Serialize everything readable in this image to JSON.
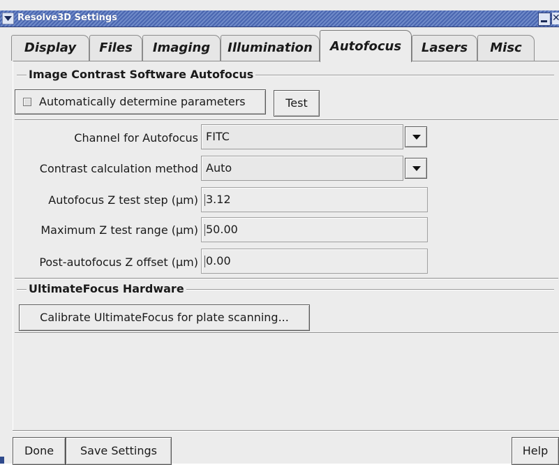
{
  "window": {
    "title": "Resolve3D Settings",
    "title_bar_color": "#4a66b0"
  },
  "tabs": [
    {
      "label": "Display",
      "active": false
    },
    {
      "label": "Files",
      "active": false
    },
    {
      "label": "Imaging",
      "active": false
    },
    {
      "label": "Illumination",
      "active": false
    },
    {
      "label": "Autofocus",
      "active": true
    },
    {
      "label": "Lasers",
      "active": false
    },
    {
      "label": "Misc",
      "active": false
    }
  ],
  "contrast_section": {
    "title": "Image Contrast Software Autofocus",
    "auto_checkbox_label": "Automatically determine parameters",
    "auto_checked": false,
    "test_button": "Test"
  },
  "fields": {
    "channel": {
      "label": "Channel for Autofocus",
      "value": "FITC"
    },
    "method": {
      "label": "Contrast calculation method",
      "value": "Auto"
    },
    "z_step": {
      "label": "Autofocus Z test step (µm)",
      "value": "3.12"
    },
    "z_range": {
      "label": "Maximum Z test range (µm)",
      "value": "50.00"
    },
    "z_offset": {
      "label": "Post-autofocus Z offset (µm)",
      "value": "0.00"
    }
  },
  "hardware_section": {
    "title": "UltimateFocus Hardware",
    "calibrate_button": "Calibrate UltimateFocus for plate scanning..."
  },
  "footer": {
    "done": "Done",
    "save": "Save Settings",
    "help": "Help"
  }
}
